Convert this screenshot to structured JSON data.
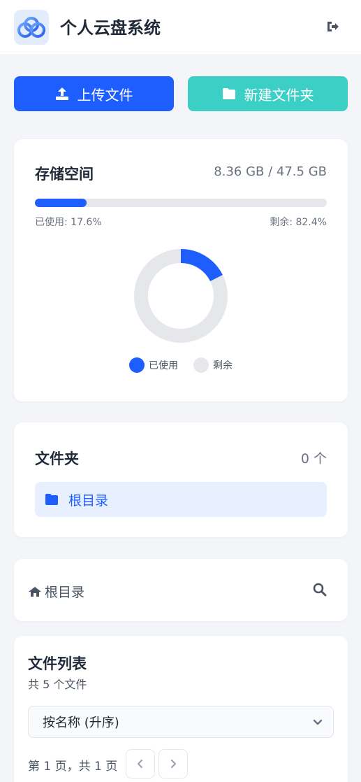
{
  "header": {
    "title": "个人云盘系统",
    "logout_icon": "sign-out-icon"
  },
  "actions": {
    "upload_label": "上传文件",
    "new_folder_label": "新建文件夹"
  },
  "storage": {
    "title": "存储空间",
    "amount": "8.36 GB / 47.5 GB",
    "used_fraction": 0.176,
    "used_text": "已使用: 17.6%",
    "free_text": "剩余: 82.4%",
    "legend_used": "已使用",
    "legend_free": "剩余",
    "colors": {
      "used": "#1e5eff",
      "free": "#e5e7eb"
    }
  },
  "folders": {
    "title": "文件夹",
    "count": "0 个",
    "root_label": "根目录"
  },
  "path": {
    "breadcrumb_label": "根目录"
  },
  "file_list": {
    "title": "文件列表",
    "count": "共 5 个文件",
    "sort_value": "按名称 (升序)",
    "page_info": "第 1 页，共 1 页"
  },
  "colors": {
    "primary": "#1e5eff",
    "teal": "#3ccfc5"
  }
}
